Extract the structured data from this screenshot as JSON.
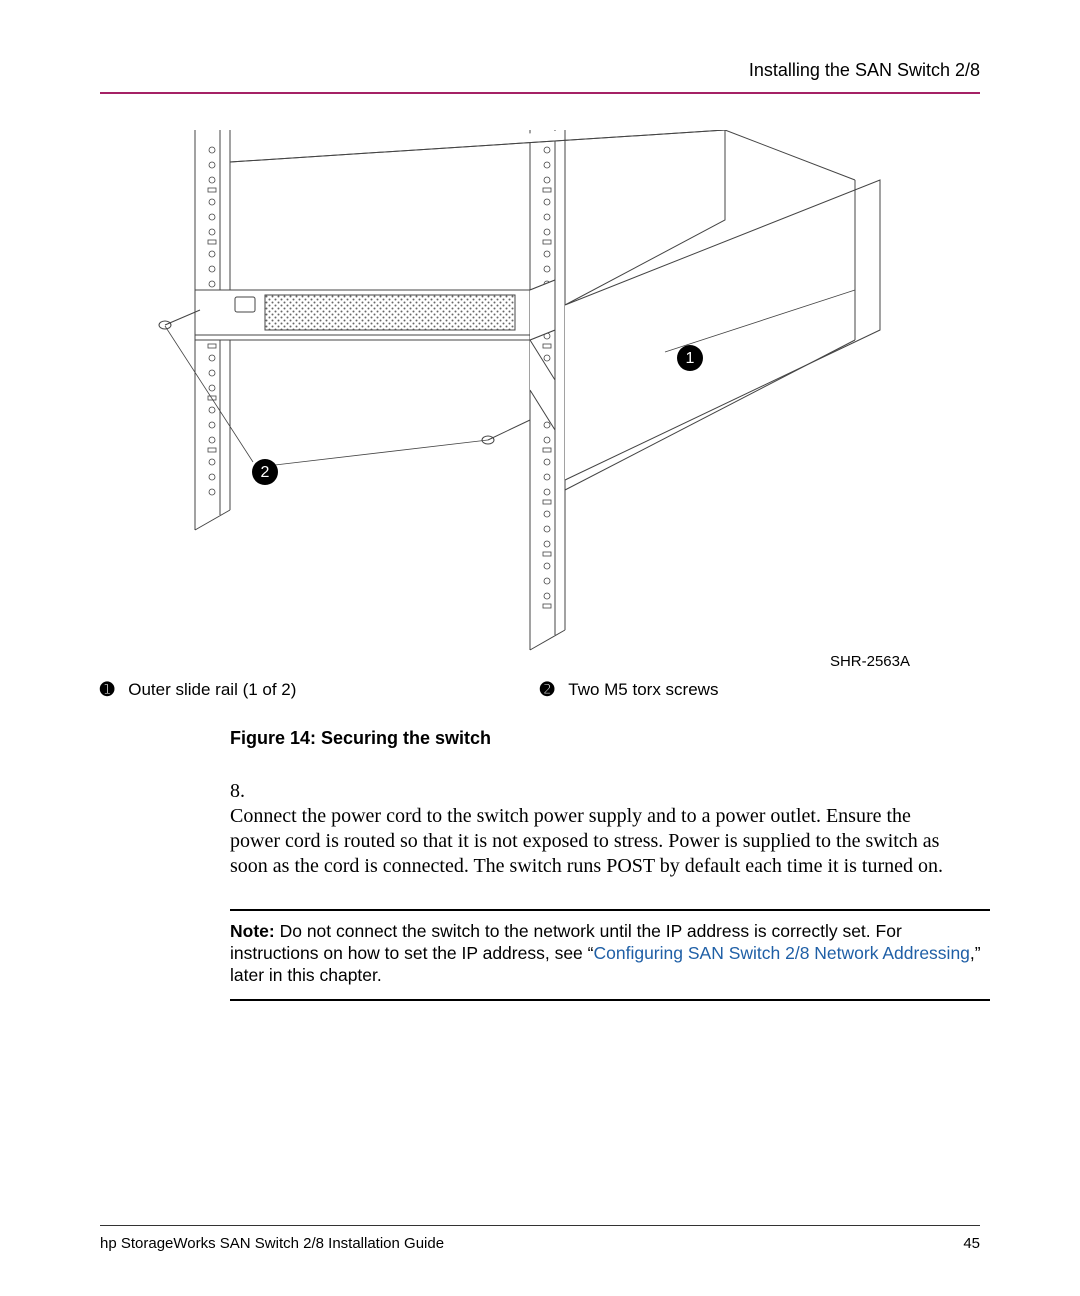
{
  "header": {
    "chapter_title": "Installing the SAN Switch 2/8"
  },
  "figure": {
    "shr_code": "SHR-2563A",
    "caption": "Figure 14:  Securing the switch",
    "callouts": {
      "one_label": "Outer slide rail (1 of 2)",
      "two_label": "Two M5 torx screws",
      "dingbat_one": "➊",
      "dingbat_two": "➋",
      "circle_one": "1",
      "circle_two": "2"
    }
  },
  "step": {
    "number": "8.",
    "text": "Connect the power cord to the switch power supply and to a power outlet. Ensure the power cord is routed so that it is not exposed to stress. Power is supplied to the switch as soon as the cord is connected. The switch runs POST by default each time it is turned on."
  },
  "note": {
    "label": "Note:",
    "part1": "  Do not connect the switch to the network until the IP address is correctly set. For instructions on how to set the IP address, see “",
    "link_text": "Configuring SAN Switch 2/8 Network Addressing",
    "part2": ",” later in this chapter."
  },
  "footer": {
    "left": "hp StorageWorks SAN Switch 2/8 Installation Guide",
    "right": "45"
  }
}
